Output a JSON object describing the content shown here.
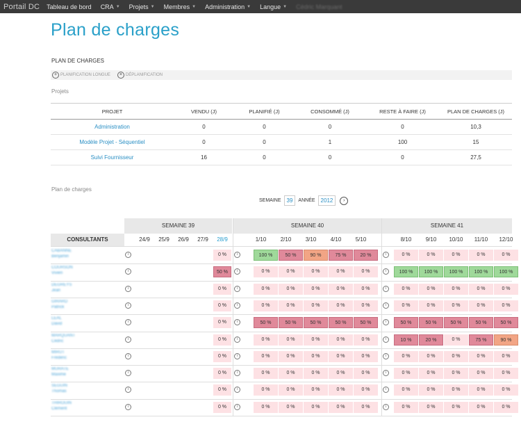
{
  "nav": {
    "brand": "Portail DC",
    "items": [
      {
        "label": "Tableau de bord",
        "caret": false
      },
      {
        "label": "CRA",
        "caret": true
      },
      {
        "label": "Projets",
        "caret": true
      },
      {
        "label": "Membres",
        "caret": true
      },
      {
        "label": "Administration",
        "caret": true
      },
      {
        "label": "Langue",
        "caret": true
      }
    ],
    "user": "Cédric Marquant"
  },
  "page": {
    "title": "Plan de charges",
    "section_title": "PLAN DE CHARGES",
    "toolbar": {
      "long_plan": "PLANIFICATION LONGUE",
      "unplan": "DÉPLANIFICATION"
    },
    "projects_label": "Projets",
    "charges_label": "Plan de charges"
  },
  "projects_table": {
    "headers": [
      "PROJET",
      "VENDU (J)",
      "PLANIFIÉ (J)",
      "CONSOMMÉ (J)",
      "RESTE À FAIRE (J)",
      "PLAN DE CHARGES (J)"
    ],
    "rows": [
      [
        "Administration",
        "0",
        "0",
        "0",
        "0",
        "10,3"
      ],
      [
        "Modèle Projet - Séquentiel",
        "0",
        "0",
        "1",
        "100",
        "15"
      ],
      [
        "Suivi Fournisseur",
        "16",
        "0",
        "0",
        "0",
        "27,5"
      ]
    ]
  },
  "week_selector": {
    "week_label": "SEMAINE",
    "week_value": "39",
    "year_label": "ANNÉE",
    "year_value": "2012"
  },
  "charge_grid": {
    "consultants_header": "CONSULTANTS",
    "weeks": [
      "SEMAINE 39",
      "SEMAINE 40",
      "SEMAINE 41"
    ],
    "days_w39": [
      "24/9",
      "25/9",
      "26/9",
      "27/9",
      "28/9"
    ],
    "days_w40": [
      "1/10",
      "2/10",
      "3/10",
      "4/10",
      "5/10"
    ],
    "days_w41": [
      "8/10",
      "9/10",
      "10/10",
      "11/10",
      "12/10"
    ],
    "rows": [
      {
        "name1": "CABANNE",
        "name2": "Benjamin",
        "w39": [
          "0 %"
        ],
        "w40": [
          "100 %",
          "50 %",
          "90 %",
          "75 %",
          "20 %"
        ],
        "w41": [
          "0 %",
          "0 %",
          "0 %",
          "0 %",
          "0 %"
        ],
        "s39": [
          "l"
        ],
        "s40": [
          "g",
          "r",
          "o",
          "r",
          "r"
        ],
        "s41": [
          "l",
          "l",
          "l",
          "l",
          "l"
        ]
      },
      {
        "name1": "COURSON",
        "name2": "Vivien",
        "w39": [
          "50 %"
        ],
        "w40": [
          "0 %",
          "0 %",
          "0 %",
          "0 %",
          "0 %"
        ],
        "w41": [
          "100 %",
          "100 %",
          "100 %",
          "100 %",
          "100 %"
        ],
        "s39": [
          "r"
        ],
        "s40": [
          "l",
          "l",
          "l",
          "l",
          "l"
        ],
        "s41": [
          "g",
          "g",
          "g",
          "g",
          "g"
        ]
      },
      {
        "name1": "DEGREYS",
        "name2": "Jean",
        "w39": [
          "0 %"
        ],
        "w40": [
          "0 %",
          "0 %",
          "0 %",
          "0 %",
          "0 %"
        ],
        "w41": [
          "0 %",
          "0 %",
          "0 %",
          "0 %",
          "0 %"
        ],
        "s39": [
          "l"
        ],
        "s40": [
          "l",
          "l",
          "l",
          "l",
          "l"
        ],
        "s41": [
          "l",
          "l",
          "l",
          "l",
          "l"
        ]
      },
      {
        "name1": "GIRARD",
        "name2": "Patrick",
        "w39": [
          "0 %"
        ],
        "w40": [
          "0 %",
          "0 %",
          "0 %",
          "0 %",
          "0 %"
        ],
        "w41": [
          "0 %",
          "0 %",
          "0 %",
          "0 %",
          "0 %"
        ],
        "s39": [
          "l"
        ],
        "s40": [
          "l",
          "l",
          "l",
          "l",
          "l"
        ],
        "s41": [
          "l",
          "l",
          "l",
          "l",
          "l"
        ]
      },
      {
        "name1": "LEAL",
        "name2": "David",
        "w39": [
          "0 %"
        ],
        "w40": [
          "50 %",
          "50 %",
          "50 %",
          "50 %",
          "50 %"
        ],
        "w41": [
          "50 %",
          "50 %",
          "50 %",
          "50 %",
          "50 %"
        ],
        "s39": [
          "l"
        ],
        "s40": [
          "r",
          "r",
          "r",
          "r",
          "r"
        ],
        "s41": [
          "r",
          "r",
          "r",
          "r",
          "r"
        ]
      },
      {
        "name1": "MARQUANT",
        "name2": "Cédric",
        "w39": [
          "0 %"
        ],
        "w40": [
          "0 %",
          "0 %",
          "0 %",
          "0 %",
          "0 %"
        ],
        "w41": [
          "10 %",
          "20 %",
          "0 %",
          "75 %",
          "90 %"
        ],
        "s39": [
          "l"
        ],
        "s40": [
          "l",
          "l",
          "l",
          "l",
          "l"
        ],
        "s41": [
          "r",
          "r",
          "l",
          "r",
          "o"
        ]
      },
      {
        "name1": "MIRUT",
        "name2": "Frédéric",
        "w39": [
          "0 %"
        ],
        "w40": [
          "0 %",
          "0 %",
          "0 %",
          "0 %",
          "0 %"
        ],
        "w41": [
          "0 %",
          "0 %",
          "0 %",
          "0 %",
          "0 %"
        ],
        "s39": [
          "l"
        ],
        "s40": [
          "l",
          "l",
          "l",
          "l",
          "l"
        ],
        "s41": [
          "l",
          "l",
          "l",
          "l",
          "l"
        ]
      },
      {
        "name1": "MURATE",
        "name2": "Maxime",
        "w39": [
          "0 %"
        ],
        "w40": [
          "0 %",
          "0 %",
          "0 %",
          "0 %",
          "0 %"
        ],
        "w41": [
          "0 %",
          "0 %",
          "0 %",
          "0 %",
          "0 %"
        ],
        "s39": [
          "l"
        ],
        "s40": [
          "l",
          "l",
          "l",
          "l",
          "l"
        ],
        "s41": [
          "l",
          "l",
          "l",
          "l",
          "l"
        ]
      },
      {
        "name1": "SEGUIN",
        "name2": "Thomas",
        "w39": [
          "0 %"
        ],
        "w40": [
          "0 %",
          "0 %",
          "0 %",
          "0 %",
          "0 %"
        ],
        "w41": [
          "0 %",
          "0 %",
          "0 %",
          "0 %",
          "0 %"
        ],
        "s39": [
          "l"
        ],
        "s40": [
          "l",
          "l",
          "l",
          "l",
          "l"
        ],
        "s41": [
          "l",
          "l",
          "l",
          "l",
          "l"
        ]
      },
      {
        "name1": "THIROUIN",
        "name2": "Clément",
        "w39": [
          "0 %"
        ],
        "w40": [
          "0 %",
          "0 %",
          "0 %",
          "0 %",
          "0 %"
        ],
        "w41": [
          "0 %",
          "0 %",
          "0 %",
          "0 %",
          "0 %"
        ],
        "s39": [
          "l"
        ],
        "s40": [
          "l",
          "l",
          "l",
          "l",
          "l"
        ],
        "s41": [
          "l",
          "l",
          "l",
          "l",
          "l"
        ]
      }
    ]
  }
}
